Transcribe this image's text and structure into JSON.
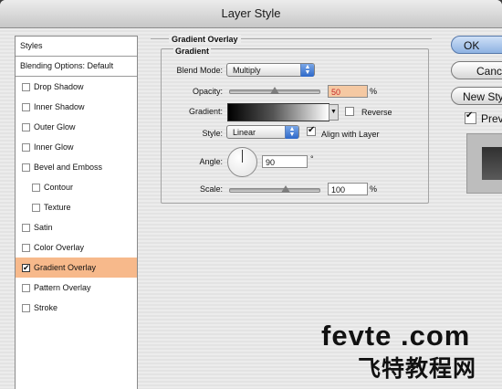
{
  "window": {
    "title": "Layer Style"
  },
  "styles_list": {
    "header": "Styles",
    "blending": "Blending Options: Default",
    "items": [
      {
        "label": "Drop Shadow",
        "checked": false,
        "sub": false
      },
      {
        "label": "Inner Shadow",
        "checked": false,
        "sub": false
      },
      {
        "label": "Outer Glow",
        "checked": false,
        "sub": false
      },
      {
        "label": "Inner Glow",
        "checked": false,
        "sub": false
      },
      {
        "label": "Bevel and Emboss",
        "checked": false,
        "sub": false
      },
      {
        "label": "Contour",
        "checked": false,
        "sub": true
      },
      {
        "label": "Texture",
        "checked": false,
        "sub": true
      },
      {
        "label": "Satin",
        "checked": false,
        "sub": false
      },
      {
        "label": "Color Overlay",
        "checked": false,
        "sub": false
      },
      {
        "label": "Gradient Overlay",
        "checked": true,
        "sub": false,
        "selected": true
      },
      {
        "label": "Pattern Overlay",
        "checked": false,
        "sub": false
      },
      {
        "label": "Stroke",
        "checked": false,
        "sub": false
      }
    ]
  },
  "panel": {
    "group_title": "Gradient Overlay",
    "inner_title": "Gradient",
    "blend_mode_label": "Blend Mode:",
    "blend_mode_value": "Multiply",
    "opacity_label": "Opacity:",
    "opacity_value": "50",
    "opacity_unit": "%",
    "gradient_label": "Gradient:",
    "reverse_label": "Reverse",
    "style_label": "Style:",
    "style_value": "Linear",
    "align_label": "Align with Layer",
    "angle_label": "Angle:",
    "angle_value": "90",
    "angle_unit": "°",
    "scale_label": "Scale:",
    "scale_value": "100",
    "scale_unit": "%"
  },
  "buttons": {
    "ok": "OK",
    "cancel": "Cancel",
    "new_style": "New Style...",
    "preview": "Preview"
  },
  "watermark": {
    "line1": "fevte .com",
    "line2": "飞特教程网"
  },
  "colors": {
    "selected_row": "#f7b98b",
    "default_button": "#8eb2e2"
  }
}
